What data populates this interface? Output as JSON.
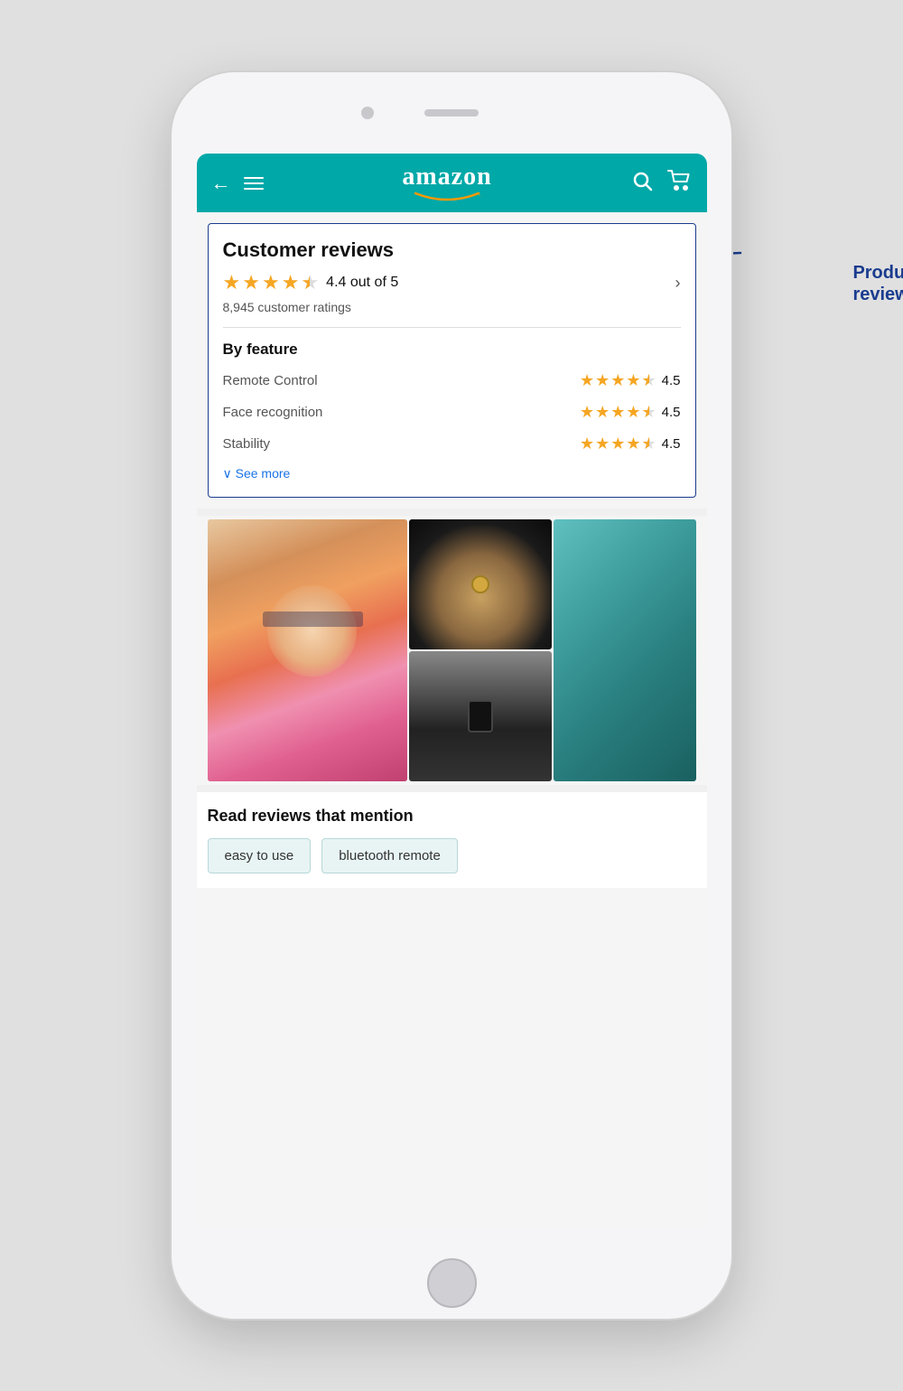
{
  "header": {
    "back_icon": "←",
    "logo_text": "amazon",
    "search_icon": "🔍",
    "cart_icon": "🛒"
  },
  "reviews": {
    "title": "Customer reviews",
    "rating": "4.4 out of 5",
    "rating_value": 4.4,
    "total_ratings": "8,945 customer ratings",
    "by_feature_label": "By feature",
    "features": [
      {
        "name": "Remote Control",
        "rating": "4.5"
      },
      {
        "name": "Face recognition",
        "rating": "4.5"
      },
      {
        "name": "Stability",
        "rating": "4.5"
      }
    ],
    "see_more_label": "∨ See more"
  },
  "read_reviews": {
    "title": "Read reviews that mention",
    "tags": [
      {
        "label": "easy to use"
      },
      {
        "label": "bluetooth remote"
      }
    ]
  },
  "annotation": {
    "label": "Product\nreviews"
  }
}
